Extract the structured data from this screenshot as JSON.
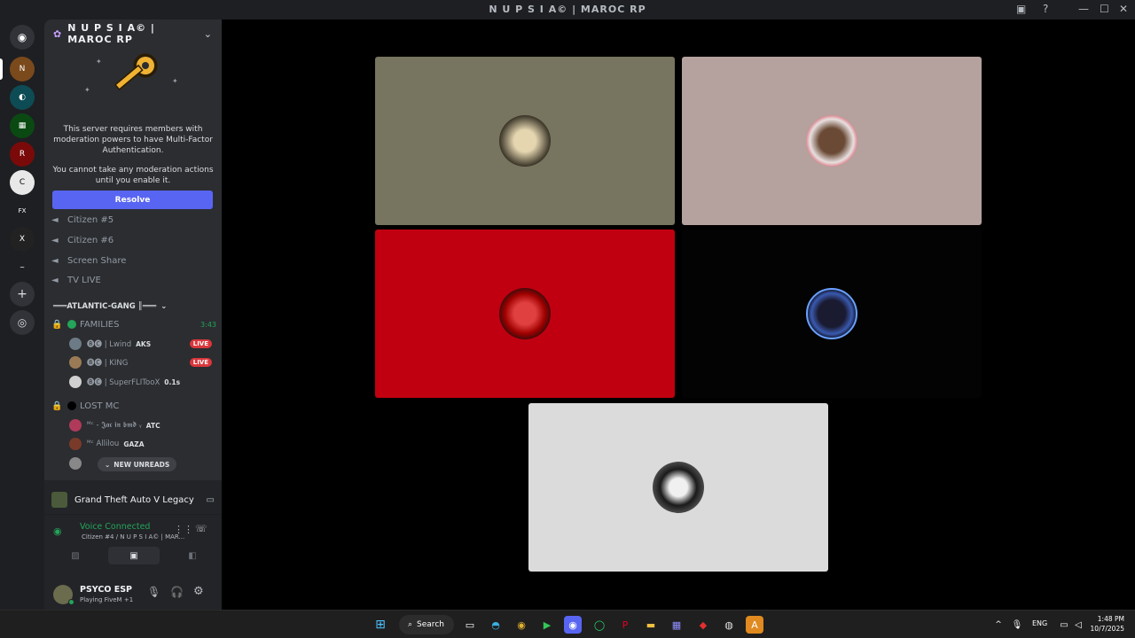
{
  "window": {
    "title": "N U P S I A© | MAROC RP"
  },
  "server": {
    "name": "N U P S I A© | MAROC RP"
  },
  "mfa_banner": {
    "line1": "This server requires members with moderation powers to have Multi-Factor Authentication.",
    "line2": "You cannot take any moderation actions until you enable it.",
    "button": "Resolve"
  },
  "channels": {
    "citizen5": "Citizen #5",
    "citizen6": "Citizen #6",
    "screen_share": "Screen Share",
    "tv_live": "TV LIVE",
    "category": "═══ATLANTIC-GANG ║═══",
    "families": "FAMILIES",
    "families_timer": "3:43",
    "lost_mc": "LOST MC"
  },
  "members": {
    "families": [
      {
        "name": "🅑🅒 | Lwind",
        "tag": "AKS",
        "live": true
      },
      {
        "name": "🅑🅒 | KING",
        "tag": "",
        "live": true
      },
      {
        "name": "🅑🅒 | SuperFLITooX",
        "tag": "0.1s",
        "live": false
      }
    ],
    "lost_mc": [
      {
        "name": "ᴹᶜ - 𝕵𝖆𝖈 𝖎𝖓 𝖇𝖒𝖉 ᵧ",
        "tag": "ATC",
        "live": false
      },
      {
        "name": "ᴹᶜ Allilou",
        "tag": "GAZA",
        "live": false
      }
    ],
    "live_label": "LIVE",
    "new_unreads": "NEW UNREADS"
  },
  "activity": {
    "game": "Grand Theft Auto V Legacy"
  },
  "voice": {
    "status": "Voice Connected",
    "channel": "Citizen #4 / N U P S I A© | MAR..."
  },
  "user": {
    "name": "PSYCO ESP",
    "status": "Playing FiveM +1"
  },
  "colors": {
    "tile1": "#77745f",
    "tile2": "#b5a19d",
    "tile3": "#c00010",
    "tile4": "#030303",
    "tile5": "#dbdbdb",
    "accent": "#5865f2",
    "live": "#da373c",
    "online": "#23a55a"
  },
  "taskbar": {
    "search": "Search",
    "lang": "ENG",
    "time": "1:48 PM",
    "date": "10/7/2025"
  }
}
